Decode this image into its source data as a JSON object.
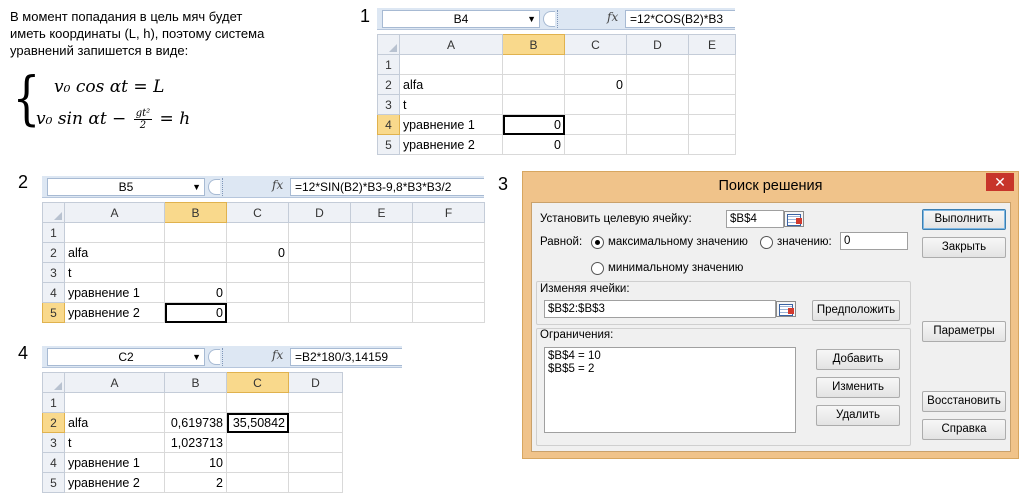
{
  "intro": {
    "lines": [
      "В момент попадания в цель мяч будет",
      "иметь координаты (L, h), поэтому система",
      "уравнений запишется в виде:"
    ],
    "eq1": "v₀ cos αt = L",
    "eq2_left": "v₀ sin αt −",
    "eq2_num": "gt²",
    "eq2_den": "2",
    "eq2_right": "= h"
  },
  "steps": {
    "s1": "1",
    "s2": "2",
    "s3": "3",
    "s4": "4"
  },
  "panel1": {
    "namebox": "B4",
    "formula": "=12*COS(B2)*B3",
    "columns": [
      "A",
      "B",
      "C",
      "D",
      "E"
    ],
    "rows": [
      {
        "n": "1",
        "a": "",
        "b": "",
        "c": ""
      },
      {
        "n": "2",
        "a": "alfa",
        "b": "",
        "c": "0"
      },
      {
        "n": "3",
        "a": "t",
        "b": "",
        "c": ""
      },
      {
        "n": "4",
        "a": "уравнение 1",
        "b": "0",
        "c": ""
      },
      {
        "n": "5",
        "a": "уравнение 2",
        "b": "0",
        "c": ""
      }
    ]
  },
  "panel2": {
    "namebox": "B5",
    "formula": "=12*SIN(B2)*B3-9,8*B3*B3/2",
    "columns": [
      "A",
      "B",
      "C",
      "D",
      "E",
      "F"
    ],
    "rows": [
      {
        "n": "1",
        "a": "",
        "b": "",
        "c": ""
      },
      {
        "n": "2",
        "a": "alfa",
        "b": "",
        "c": "0"
      },
      {
        "n": "3",
        "a": "t",
        "b": "",
        "c": ""
      },
      {
        "n": "4",
        "a": "уравнение 1",
        "b": "0",
        "c": ""
      },
      {
        "n": "5",
        "a": "уравнение 2",
        "b": "0",
        "c": ""
      }
    ]
  },
  "panel4": {
    "namebox": "C2",
    "formula": "=B2*180/3,14159",
    "columns": [
      "A",
      "B",
      "C",
      "D"
    ],
    "rows": [
      {
        "n": "1",
        "a": "",
        "b": "",
        "c": ""
      },
      {
        "n": "2",
        "a": "alfa",
        "b": "0,619738",
        "c": "35,50842"
      },
      {
        "n": "3",
        "a": "t",
        "b": "1,023713",
        "c": ""
      },
      {
        "n": "4",
        "a": "уравнение 1",
        "b": "10",
        "c": ""
      },
      {
        "n": "5",
        "a": "уравнение 2",
        "b": "2",
        "c": ""
      }
    ]
  },
  "dialog": {
    "title": "Поиск решения",
    "close": "✕",
    "target_label": "Установить целевую ячейку:",
    "target_value": "$B$4",
    "equal_label": "Равной:",
    "radio_max": "максимальному значению",
    "radio_value": "значению:",
    "value_field": "0",
    "radio_min": "минимальному значению",
    "changing_label": "Изменяя ячейки:",
    "changing_value": "$B$2:$B$3",
    "guess_button": "Предположить",
    "constraints_label": "Ограничения:",
    "constraints": [
      "$B$4 = 10",
      "$B$5 = 2"
    ],
    "buttons": {
      "solve": "Выполнить",
      "close": "Закрыть",
      "options": "Параметры",
      "add": "Добавить",
      "change": "Изменить",
      "delete": "Удалить",
      "reset": "Восстановить",
      "help": "Справка"
    }
  }
}
